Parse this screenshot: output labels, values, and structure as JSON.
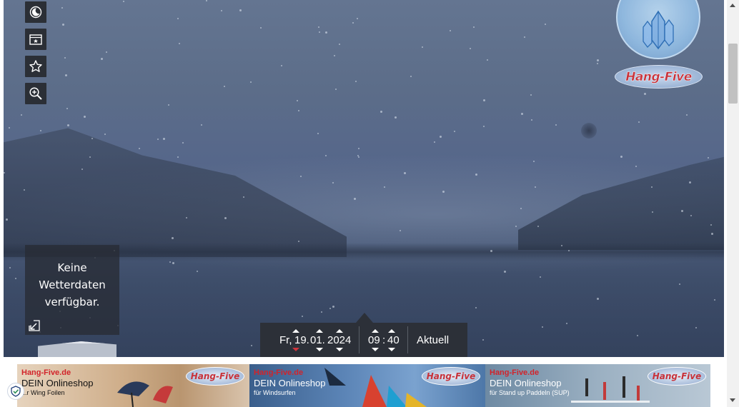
{
  "toolbar": {
    "items": [
      {
        "name": "night-mode-icon",
        "label": ""
      },
      {
        "name": "gallery-icon",
        "label": ""
      },
      {
        "name": "favorite-star-icon",
        "label": ""
      },
      {
        "name": "zoom-in-icon",
        "label": ""
      }
    ]
  },
  "weather": {
    "message": "Keine Wetterdaten verfügbar.",
    "collapse_icon": "collapse-arrow-icon"
  },
  "datetime": {
    "weekday": "Fr,",
    "day": "19.",
    "month": "01.",
    "year": "2024",
    "hour": "09",
    "time_separator": ":",
    "minute": "40",
    "current_label": "Aktuell"
  },
  "logos": {
    "hangfive_text": "Hang-Five"
  },
  "ads": [
    {
      "brand": "Hang-Five.de",
      "headline": "DEIN Onlineshop",
      "sub": "...r Wing Foilen",
      "logo": "Hang-Five"
    },
    {
      "brand": "Hang-Five.de",
      "headline": "DEIN Onlineshop",
      "sub": "für Windsurfen",
      "logo": "Hang-Five"
    },
    {
      "brand": "Hang-Five.de",
      "headline": "DEIN Onlineshop",
      "sub": "für Stand up Paddeln (SUP)",
      "logo": "Hang-Five"
    }
  ],
  "colors": {
    "toolbar_bg": "#2b2f36",
    "panel_bg": "#2c3038",
    "accent_red": "#d0343c",
    "brand_red": "#d2232a"
  }
}
